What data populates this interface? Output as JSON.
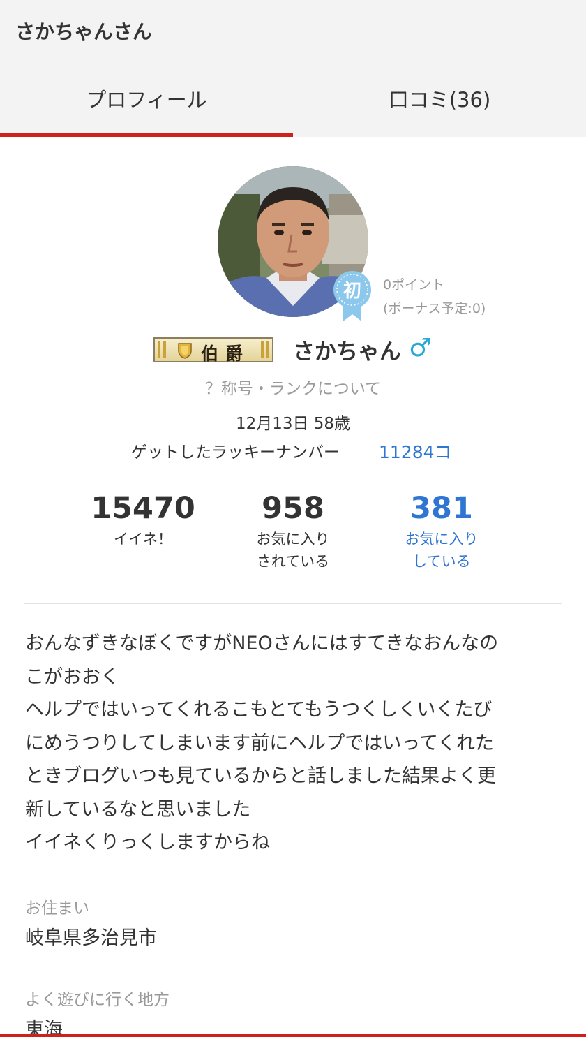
{
  "header": {
    "title": "さかちゃんさん"
  },
  "tabs": [
    {
      "label": "プロフィール",
      "active": true
    },
    {
      "label": "口コミ(36)",
      "active": false
    }
  ],
  "profile": {
    "badge_text": "初",
    "points": "0ポイント",
    "bonus": "(ボーナス予定:0)",
    "rank_title": "伯爵",
    "name": "さかちゃん",
    "gender_symbol": "♂",
    "rank_link": "？称号・ランクについて",
    "birthday": "12月13日 58歳",
    "lucky_label": "ゲットしたラッキーナンバー",
    "lucky_value": "11284コ"
  },
  "stats": [
    {
      "value": "15470",
      "label_line1": "イイネ！",
      "label_line2": ""
    },
    {
      "value": "958",
      "label_line1": "お気に入り",
      "label_line2": "されている"
    },
    {
      "value": "381",
      "label_line1": "お気に入り",
      "label_line2": "している"
    }
  ],
  "bio": [
    "おんなずきなぼくですがNEOさんにはすてきなおんなの",
    "こがおおく",
    "ヘルプではいってくれるこもとてもうつくしくいくたび",
    "にめうつりしてしまいます前にヘルプではいってくれた",
    "ときブログいつも見ているからと話しました結果よく更",
    "新しているなと思いました",
    "イイネくりっくしますからね"
  ],
  "fields": [
    {
      "label": "お住まい",
      "value": "岐阜県多治見市"
    },
    {
      "label": "よく遊びに行く地方",
      "value": "東海"
    }
  ],
  "colors": {
    "accent_red": "#d0201b",
    "link_blue": "#2f76d2",
    "gender_blue": "#29a8d6",
    "badge_blue": "#8cc7ec"
  }
}
